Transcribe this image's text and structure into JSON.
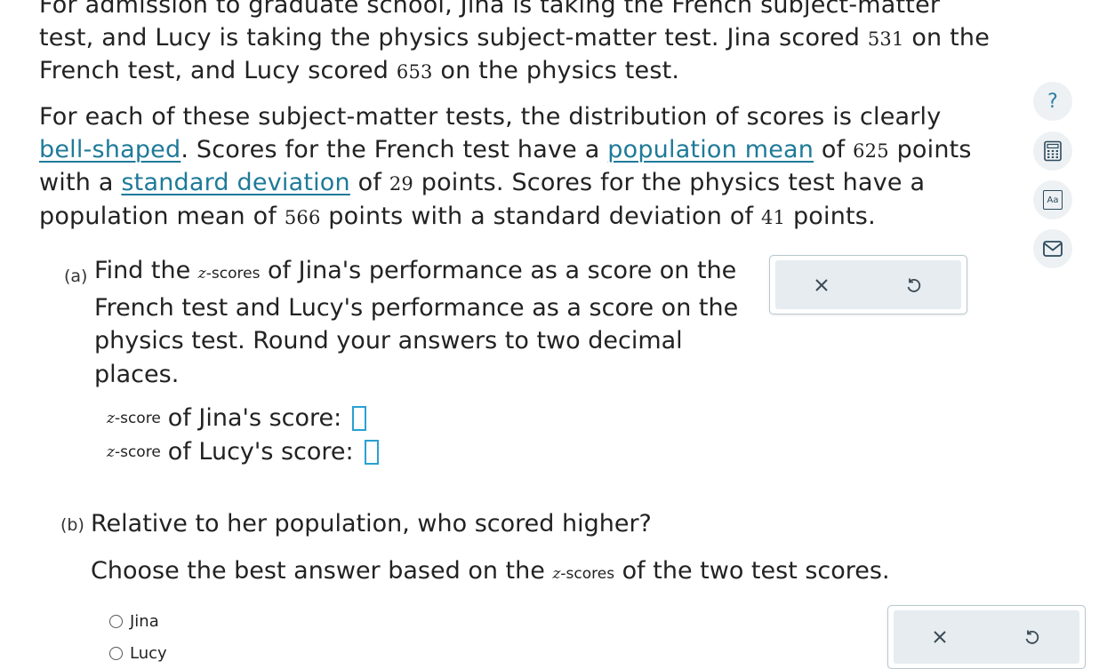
{
  "intro": {
    "p1_a": "For admission to graduate school, Jina is taking the French subject-matter test, and Lucy is taking the physics subject-matter test. Jina scored ",
    "jina_score": "531",
    "p1_b": " on the French test, and Lucy scored ",
    "lucy_score": "653",
    "p1_c": " on the physics test.",
    "p2_a": "For each of these subject-matter tests, the distribution of scores is clearly ",
    "link_bell": "bell-shaped",
    "p2_b": ". Scores for the French test have a ",
    "link_mean": "population mean",
    "p2_c": " of ",
    "french_mean": "625",
    "p2_d": " points with a ",
    "link_sd": "standard deviation",
    "p2_e": " of ",
    "french_sd": "29",
    "p2_f": " points. Scores for the physics test have a population mean of ",
    "physics_mean": "566",
    "p2_g": " points with a standard deviation of ",
    "physics_sd": "41",
    "p2_h": " points."
  },
  "part_a": {
    "label": "(a)",
    "text_a": "Find the ",
    "z_var": "z",
    "zscores_word": "-scores",
    "text_b": " of Jina's performance as a score on the French test and Lucy's performance as a score on the physics test. Round your answers to two decimal places.",
    "zscore_word": "-score",
    "row1_text": " of Jina's score:",
    "row2_text": " of Lucy's score:"
  },
  "part_b": {
    "label": "(b)",
    "question": "Relative to her population, who scored higher?",
    "inst_a": "Choose the best answer based on the ",
    "inst_b": " of the two test scores.",
    "options": [
      "Jina",
      "Lucy"
    ]
  },
  "panel_icons": {
    "clear": "×"
  },
  "sidebar": {
    "help": "?",
    "dictionary": "Aa"
  },
  "colors": {
    "link": "#1f7a99",
    "answer_box": "#2aa0d2",
    "panel_bg": "#e6ecef"
  }
}
